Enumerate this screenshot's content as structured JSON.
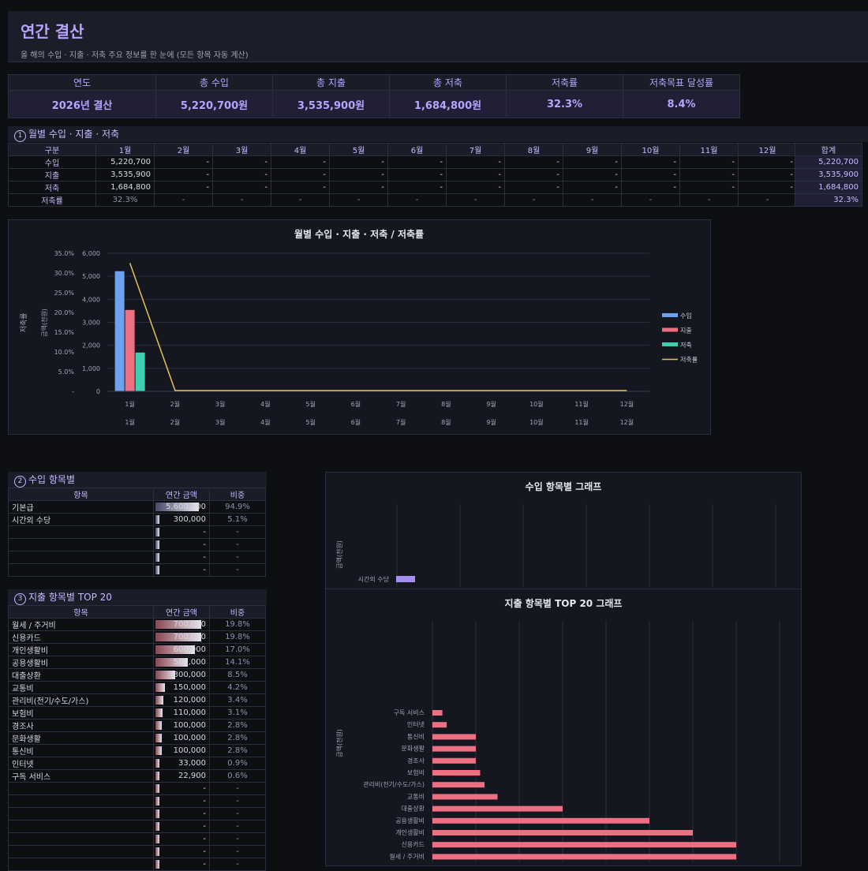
{
  "header": {
    "title": "연간 결산",
    "subtitle": "올 해의 수입 · 지출 · 저축 주요 정보를 한 눈에 (모든 항목 자동 계산)"
  },
  "summary": {
    "headers": [
      "연도",
      "총 수입",
      "총 지출",
      "총 저축",
      "저축률",
      "저축목표 달성률"
    ],
    "values": [
      "2026년 결산",
      "5,220,700원",
      "3,535,900원",
      "1,684,800원",
      "32.3%",
      "8.4%"
    ]
  },
  "monthly": {
    "section_no": "1",
    "section_title": "월별 수입 · 지출 · 저축",
    "corner": "구분",
    "months": [
      "1월",
      "2월",
      "3월",
      "4월",
      "5월",
      "6월",
      "7월",
      "8월",
      "9월",
      "10월",
      "11월",
      "12월"
    ],
    "rows": [
      {
        "label": "수입",
        "values": [
          "5,220,700",
          "-",
          "-",
          "-",
          "-",
          "-",
          "-",
          "-",
          "-",
          "-",
          "-",
          "-"
        ]
      },
      {
        "label": "지출",
        "values": [
          "3,535,900",
          "-",
          "-",
          "-",
          "-",
          "-",
          "-",
          "-",
          "-",
          "-",
          "-",
          "-"
        ]
      },
      {
        "label": "저축",
        "values": [
          "1,684,800",
          "-",
          "-",
          "-",
          "-",
          "-",
          "-",
          "-",
          "-",
          "-",
          "-",
          "-"
        ]
      },
      {
        "label": "저축률",
        "values": [
          "32.3%",
          "-",
          "-",
          "-",
          "-",
          "-",
          "-",
          "-",
          "-",
          "-",
          "-",
          "-"
        ]
      }
    ],
    "total_header": "합계",
    "totals": [
      "5,220,700",
      "3,535,900",
      "1,684,800",
      "32.3%"
    ]
  },
  "income_section": {
    "section_no": "2",
    "section_title": "수입 항목별",
    "headers": [
      "항목",
      "연간 금액",
      "비중"
    ],
    "rows": [
      {
        "name": "기본급",
        "amount": "5,600,000",
        "share": "94.9%",
        "fill": 0.949
      },
      {
        "name": "시간외 수당",
        "amount": "300,000",
        "share": "5.1%",
        "fill": 0.051
      },
      {
        "name": "",
        "amount": "-",
        "share": "-",
        "fill": 0
      },
      {
        "name": "",
        "amount": "-",
        "share": "-",
        "fill": 0
      },
      {
        "name": "",
        "amount": "-",
        "share": "-",
        "fill": 0
      },
      {
        "name": "",
        "amount": "-",
        "share": "-",
        "fill": 0
      }
    ]
  },
  "expense_section": {
    "section_no": "3",
    "section_title": "지출 항목별 TOP 20",
    "headers": [
      "항목",
      "연간 금액",
      "비중"
    ],
    "rows": [
      {
        "name": "월세 / 주거비",
        "amount": "700,000",
        "share": "19.8%",
        "fill": 1.0
      },
      {
        "name": "신용카드",
        "amount": "700,000",
        "share": "19.8%",
        "fill": 1.0
      },
      {
        "name": "개인생활비",
        "amount": "600,000",
        "share": "17.0%",
        "fill": 0.857
      },
      {
        "name": "공용생활비",
        "amount": "500,000",
        "share": "14.1%",
        "fill": 0.714
      },
      {
        "name": "대출상환",
        "amount": "300,000",
        "share": "8.5%",
        "fill": 0.429
      },
      {
        "name": "교통비",
        "amount": "150,000",
        "share": "4.2%",
        "fill": 0.214
      },
      {
        "name": "관리비(전기/수도/가스)",
        "amount": "120,000",
        "share": "3.4%",
        "fill": 0.171
      },
      {
        "name": "보험비",
        "amount": "110,000",
        "share": "3.1%",
        "fill": 0.157
      },
      {
        "name": "경조사",
        "amount": "100,000",
        "share": "2.8%",
        "fill": 0.143
      },
      {
        "name": "문화생활",
        "amount": "100,000",
        "share": "2.8%",
        "fill": 0.143
      },
      {
        "name": "통신비",
        "amount": "100,000",
        "share": "2.8%",
        "fill": 0.143
      },
      {
        "name": "인터넷",
        "amount": "33,000",
        "share": "0.9%",
        "fill": 0.047
      },
      {
        "name": "구독 서비스",
        "amount": "22,900",
        "share": "0.6%",
        "fill": 0.033
      },
      {
        "name": "",
        "amount": "-",
        "share": "-",
        "fill": 0
      },
      {
        "name": "",
        "amount": "-",
        "share": "-",
        "fill": 0
      },
      {
        "name": "",
        "amount": "-",
        "share": "-",
        "fill": 0
      },
      {
        "name": "",
        "amount": "-",
        "share": "-",
        "fill": 0
      },
      {
        "name": "",
        "amount": "-",
        "share": "-",
        "fill": 0
      },
      {
        "name": "",
        "amount": "-",
        "share": "-",
        "fill": 0
      },
      {
        "name": "",
        "amount": "-",
        "share": "-",
        "fill": 0
      }
    ]
  },
  "colors": {
    "income": "#6ea2ee",
    "expense": "#ec6f82",
    "saving": "#3ccfb2",
    "rate": "#e8c05a",
    "income_bar": "#a58ff0",
    "accent": "#b7a4ff"
  },
  "chart_data": [
    {
      "type": "bar",
      "title": "월별 수입 · 지출 · 저축 / 저축률",
      "ylabel": "금액(천원)",
      "y2label": "저축률",
      "categories": [
        "1월",
        "2월",
        "3월",
        "4월",
        "5월",
        "6월",
        "7월",
        "8월",
        "9월",
        "10월",
        "11월",
        "12월"
      ],
      "series": [
        {
          "name": "수입",
          "kind": "bar",
          "values": [
            5220.7,
            0,
            0,
            0,
            0,
            0,
            0,
            0,
            0,
            0,
            0,
            0
          ]
        },
        {
          "name": "지출",
          "kind": "bar",
          "values": [
            3535.9,
            0,
            0,
            0,
            0,
            0,
            0,
            0,
            0,
            0,
            0,
            0
          ]
        },
        {
          "name": "저축",
          "kind": "bar",
          "values": [
            1684.8,
            0,
            0,
            0,
            0,
            0,
            0,
            0,
            0,
            0,
            0,
            0
          ]
        },
        {
          "name": "저축률",
          "kind": "line",
          "values": [
            32.3,
            0,
            0,
            0,
            0,
            0,
            0,
            0,
            0,
            0,
            0,
            0
          ]
        }
      ],
      "ylim": [
        0,
        6000
      ],
      "y2lim": [
        0,
        35
      ],
      "yticks": [
        "6,000",
        "5,000",
        "4,000",
        "3,000",
        "2,000",
        "1,000",
        "0"
      ],
      "y2ticks": [
        "35.0%",
        "30.0%",
        "25.0%",
        "20.0%",
        "15.0%",
        "10.0%",
        "5.0%",
        "-"
      ],
      "legend": "right"
    },
    {
      "type": "bar",
      "title": "수입 항목별 그래프",
      "ylabel": "금액(천원)",
      "orientation": "horizontal",
      "categories": [
        "시간외 수당"
      ],
      "values": [
        300
      ]
    },
    {
      "type": "bar",
      "title": "지출 항목별 TOP 20 그래프",
      "ylabel": "금액(천원)",
      "orientation": "horizontal",
      "categories": [
        "구독 서비스",
        "인터넷",
        "통신비",
        "문화생활",
        "경조사",
        "보험비",
        "관리비(전기/수도/가스)",
        "교통비",
        "대출상환",
        "공용생활비",
        "개인생활비",
        "신용카드",
        "월세 / 주거비"
      ],
      "values": [
        22.9,
        33,
        100,
        100,
        100,
        110,
        120,
        150,
        300,
        500,
        600,
        700,
        700
      ],
      "xlim": [
        0,
        800
      ]
    }
  ]
}
